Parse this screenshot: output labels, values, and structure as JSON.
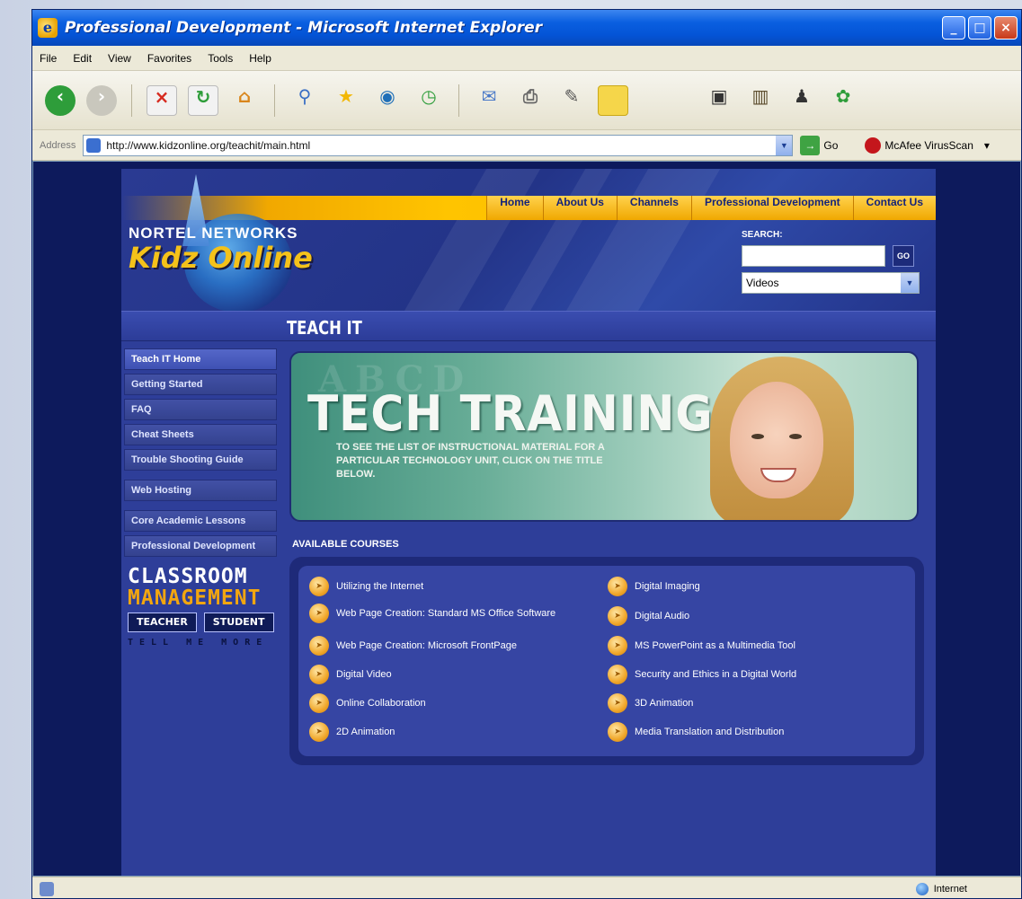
{
  "window": {
    "title": "Professional Development - Microsoft Internet Explorer"
  },
  "menubar": [
    "File",
    "Edit",
    "View",
    "Favorites",
    "Tools",
    "Help"
  ],
  "toolbar_icons": [
    "back-icon",
    "forward-icon",
    "stop-icon",
    "refresh-icon",
    "home-icon",
    "search-icon",
    "favorites-star-icon",
    "media-icon",
    "history-icon",
    "mail-icon",
    "print-icon",
    "edit-icon",
    "discuss-icon",
    "research-icon",
    "messenger-icon",
    "msn-icon"
  ],
  "address": {
    "label": "Address",
    "url": "http://www.kidzonline.org/teachit/main.html",
    "go_label": "Go",
    "mcafee_label": "McAfee VirusScan"
  },
  "site": {
    "logo_top": "NORTEL NETWORKS",
    "logo_bottom": "Kidz Online",
    "nav": [
      "Home",
      "About Us",
      "Channels",
      "Professional Development",
      "Contact Us"
    ],
    "search": {
      "label": "SEARCH:",
      "value": "",
      "go_label": "GO",
      "selected": "Videos"
    },
    "section_title": "TEACH IT"
  },
  "sidebar": {
    "group1": [
      "Teach IT Home",
      "Getting Started",
      "FAQ",
      "Cheat Sheets",
      "Trouble Shooting Guide"
    ],
    "group2": [
      "Web Hosting"
    ],
    "group3": [
      "Core Academic Lessons",
      "Professional Development"
    ],
    "classroom": {
      "line1": "CLASSROOM",
      "line2": "MANAGEMENT",
      "teacher": "TEACHER",
      "student": "STUDENT",
      "tell": "TELL ME MORE"
    }
  },
  "banner": {
    "headline": "TECH TRAINING",
    "sub": "TO SEE THE LIST OF INSTRUCTIONAL MATERIAL FOR A PARTICULAR TECHNOLOGY UNIT, CLICK ON THE TITLE BELOW."
  },
  "courses": {
    "title": "AVAILABLE COURSES",
    "left": [
      "Utilizing the Internet",
      "Web Page Creation: Standard MS Office Software",
      "Web Page Creation: Microsoft FrontPage",
      "Digital Video",
      "Online Collaboration",
      "2D Animation"
    ],
    "right": [
      "Digital Imaging",
      "Digital Audio",
      "MS PowerPoint as a Multimedia Tool",
      "Security and Ethics in a Digital World",
      "3D Animation",
      "Media Translation and Distribution"
    ]
  },
  "status": {
    "zone": "Internet"
  }
}
